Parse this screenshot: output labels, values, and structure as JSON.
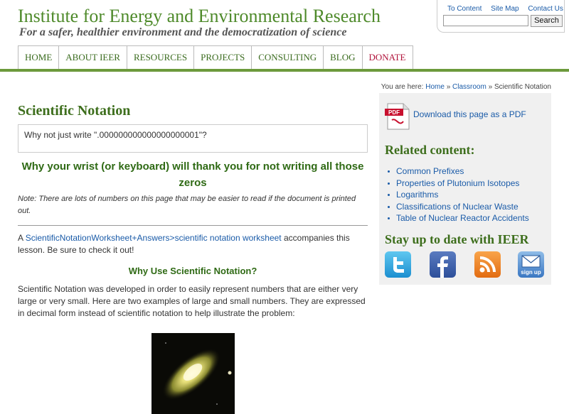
{
  "header": {
    "site_title": "Institute for Energy and Environmental Research",
    "tagline": "For a safer, healthier environment and the democratization of science"
  },
  "utility": {
    "to_content": "To Content",
    "site_map": "Site Map",
    "contact_us": "Contact Us",
    "search_placeholder": "",
    "search_button": "Search"
  },
  "nav": {
    "items": [
      {
        "label": "HOME"
      },
      {
        "label": "ABOUT IEER"
      },
      {
        "label": "RESOURCES"
      },
      {
        "label": "PROJECTS"
      },
      {
        "label": "CONSULTING"
      },
      {
        "label": "BLOG"
      },
      {
        "label": "DONATE"
      }
    ]
  },
  "breadcrumb": {
    "prefix": "You are here:",
    "home": "Home",
    "sep": "»",
    "classroom": "Classroom",
    "current": "Scientific Notation"
  },
  "main": {
    "title": "Scientific Notation",
    "quote": "Why not just write \".000000000000000000001\"?",
    "subhead": "Why your wrist (or keyboard) will thank you for not writing all those zeros",
    "note": "Note: There are lots of numbers on this page that may be easier to read if the document is printed out.",
    "worksheet_prefix": "A",
    "worksheet_link": "ScientificNotationWorksheet+Answers>scientific notation worksheet",
    "worksheet_suffix": "accompanies this lesson. Be sure to check it out!",
    "section_head": "Why Use Scientific Notation?",
    "body": "Scientific Notation was developed in order to easily represent numbers that are either very large or very small. Here are two examples of large and small numbers. They are expressed in decimal form instead of scientific notation to help illustrate the problem:"
  },
  "sidebar": {
    "pdf_link": "Download this page as a PDF",
    "pdf_label": "PDF",
    "related_head": "Related content:",
    "related": [
      {
        "label": "Common Prefixes"
      },
      {
        "label": "Properties of Plutonium Isotopes"
      },
      {
        "label": "Logarithms"
      },
      {
        "label": "Classifications of Nuclear Waste"
      },
      {
        "label": "Table of Nuclear Reactor Accidents"
      }
    ],
    "stay_head": "Stay up to date with IEER",
    "signup_label": "sign up"
  },
  "colors": {
    "brand_green": "#4e8a2a",
    "heading_green": "#3d6e1c",
    "link_blue": "#1a5ba8",
    "donate_red": "#b0123a",
    "bar_green": "#6c9a3c"
  }
}
